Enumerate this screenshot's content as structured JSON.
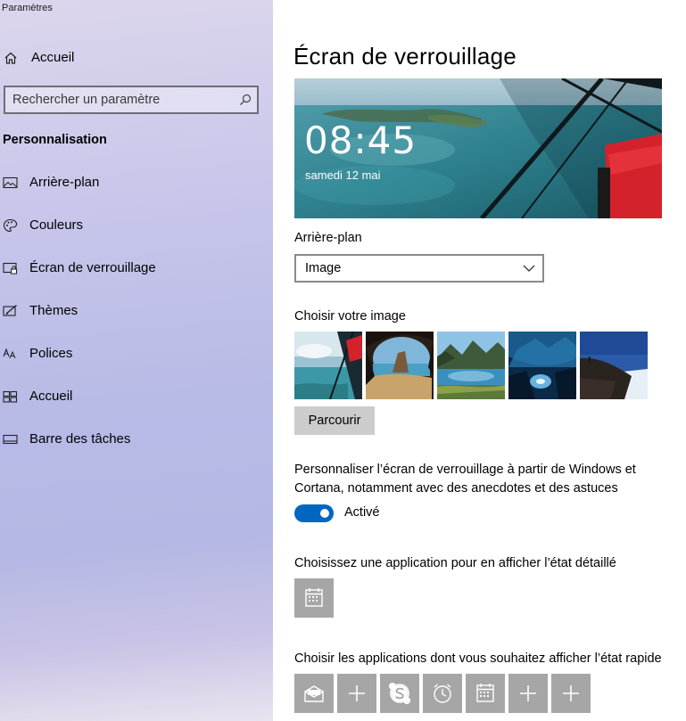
{
  "window": {
    "title": "Paramètres"
  },
  "sidebar": {
    "home_label": "Accueil",
    "search_placeholder": "Rechercher un paramètre",
    "section_title": "Personnalisation",
    "items": [
      {
        "label": "Arrière-plan",
        "icon": "picture-icon"
      },
      {
        "label": "Couleurs",
        "icon": "palette-icon"
      },
      {
        "label": "Écran de verrouillage",
        "icon": "lock-screen-icon"
      },
      {
        "label": "Thèmes",
        "icon": "themes-icon"
      },
      {
        "label": "Polices",
        "icon": "fonts-icon"
      },
      {
        "label": "Accueil",
        "icon": "start-icon"
      },
      {
        "label": "Barre des tâches",
        "icon": "taskbar-icon"
      }
    ]
  },
  "main": {
    "title": "Écran de verrouillage",
    "preview": {
      "time": "08:45",
      "date": "samedi 12 mai"
    },
    "background_label": "Arrière-plan",
    "background_value": "Image",
    "choose_image_label": "Choisir votre image",
    "browse_label": "Parcourir",
    "fun_facts_label": "Personnaliser l’écran de verrouillage à partir de Windows et Cortana, notamment avec des anecdotes et des astuces",
    "fun_facts_toggle": "Activé",
    "detailed_status_label": "Choisissez une application pour en afficher l’état détaillé",
    "quick_status_label": "Choisir les applications dont vous souhaitez afficher l’état rapide",
    "quick_apps": [
      "mail-icon",
      "plus-icon",
      "skype-icon",
      "alarm-icon",
      "calendar-icon",
      "plus-icon",
      "plus-icon"
    ]
  },
  "colors": {
    "accent": "#0067c0",
    "tile": "#a6a6a6",
    "button": "#cccccc"
  }
}
